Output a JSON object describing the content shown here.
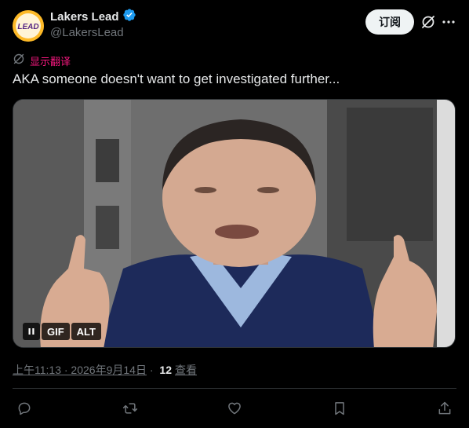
{
  "author": {
    "avatar_text": "LEAD",
    "name": "Lakers Lead",
    "handle": "@LakersLead",
    "verified": true
  },
  "header_actions": {
    "subscribe_label": "订阅",
    "grok_icon": "grok-icon",
    "more_icon": "more-icon"
  },
  "translate": {
    "label": "显示翻译"
  },
  "tweet": {
    "text": "AKA someone doesn't want to get investigated further..."
  },
  "media": {
    "type": "gif",
    "gif_label": "GIF",
    "alt_label": "ALT"
  },
  "meta": {
    "time": "上午11:13 · 2026年9月14日",
    "separator": " · ",
    "views_count": "12",
    "views_label": "查看"
  },
  "actions": [
    "reply-icon",
    "retweet-icon",
    "like-icon",
    "bookmark-icon",
    "share-icon"
  ],
  "colors": {
    "background": "#000000",
    "text": "#e7e9ea",
    "secondary": "#71767b",
    "verified": "#1d9bf0",
    "translate": "#f91880",
    "brand": "#fdb927"
  }
}
